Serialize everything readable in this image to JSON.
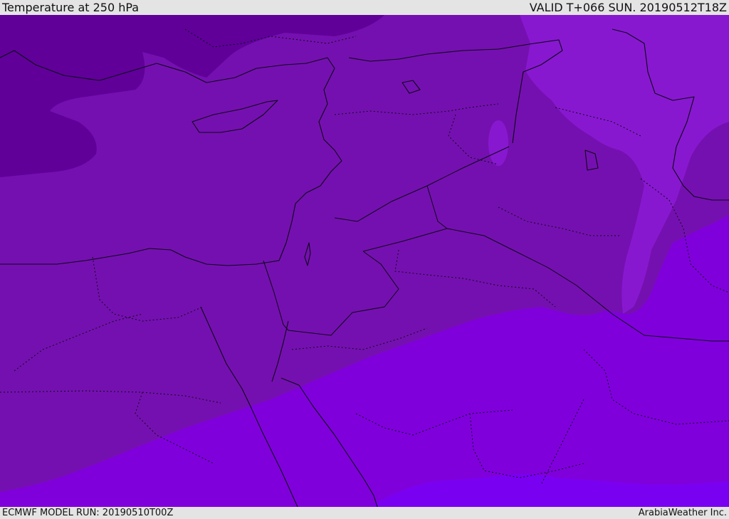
{
  "header": {
    "title": "Temperature at 250 hPa",
    "valid": "VALID T+066 SUN. 20190512T18Z"
  },
  "footer": {
    "model_run": "ECMWF MODEL RUN: 20190510T00Z",
    "credit": "ArabiaWeather Inc."
  },
  "map": {
    "variable": "temperature",
    "level": "250 hPa",
    "colors": {
      "band_coldest": "#600099",
      "band_cold": "#7510b0",
      "band_mid": "#8818d0",
      "band_warm": "#8000dc",
      "band_warmest": "#7a00f2",
      "lines": "#0c0818"
    }
  }
}
